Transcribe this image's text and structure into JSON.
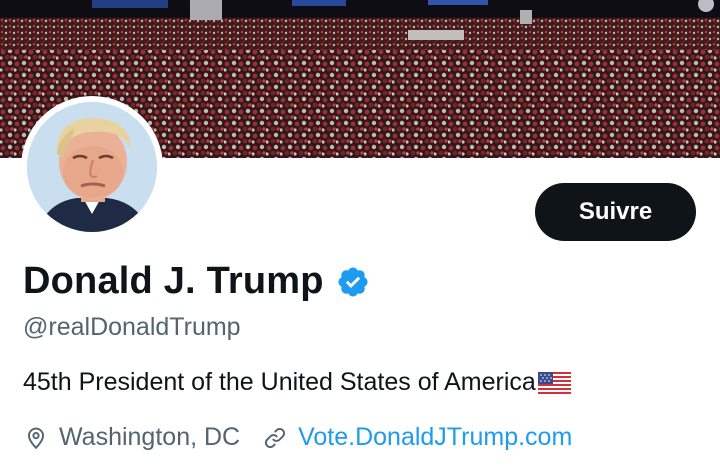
{
  "profile": {
    "display_name": "Donald J. Trump",
    "handle": "@realDonaldTrump",
    "bio": "45th President of the United States of America",
    "location": "Washington, DC",
    "website": "Vote.DonaldJTrump.com",
    "verified": true
  },
  "actions": {
    "follow_label": "Suivre"
  },
  "icons": {
    "verified": "verified-badge-icon",
    "location": "location-pin-icon",
    "link": "link-icon",
    "flag": "us-flag-emoji"
  },
  "colors": {
    "text_primary": "#0f1419",
    "text_secondary": "#536471",
    "link": "#1d9bf0",
    "verified": "#1d9bf0",
    "button_bg": "#0f1419",
    "button_text": "#ffffff"
  }
}
